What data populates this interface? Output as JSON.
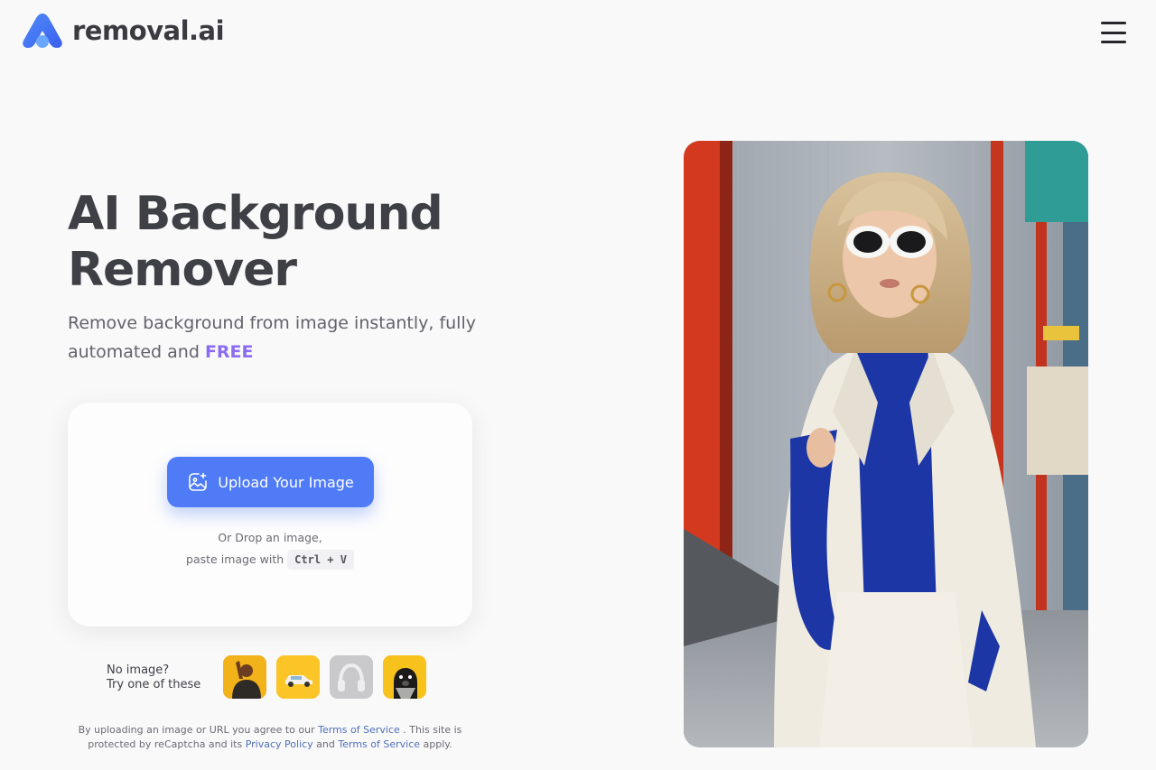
{
  "brand": {
    "name": "removal.ai"
  },
  "hero": {
    "title": "AI Background Remover",
    "subtitle_prefix": "Remove background from image instantly, fully automated and ",
    "subtitle_highlight": "FREE"
  },
  "upload": {
    "button_label": "Upload Your Image",
    "drop_line1": "Or Drop an image,",
    "drop_line2": "paste image with",
    "shortcut": "Ctrl + V"
  },
  "samples": {
    "line1": "No image?",
    "line2": "Try one of these",
    "items": [
      "person-sample",
      "car-sample",
      "headphones-sample",
      "dog-sample"
    ]
  },
  "legal": {
    "part1": "By uploading an image or URL you agree to our ",
    "tos": "Terms of Service",
    "part2": " . This site is protected by reCaptcha and its ",
    "privacy": "Privacy Policy",
    "part3": " and ",
    "tos2": "Terms of Service",
    "part4": " apply."
  },
  "colors": {
    "accent": "#4f7cf6",
    "highlight": "#8b6cf0",
    "background": "#f9f9fa"
  },
  "icons": {
    "menu": "hamburger-icon",
    "upload": "image-sparkle-icon",
    "logo": "removal-ai-logo"
  }
}
